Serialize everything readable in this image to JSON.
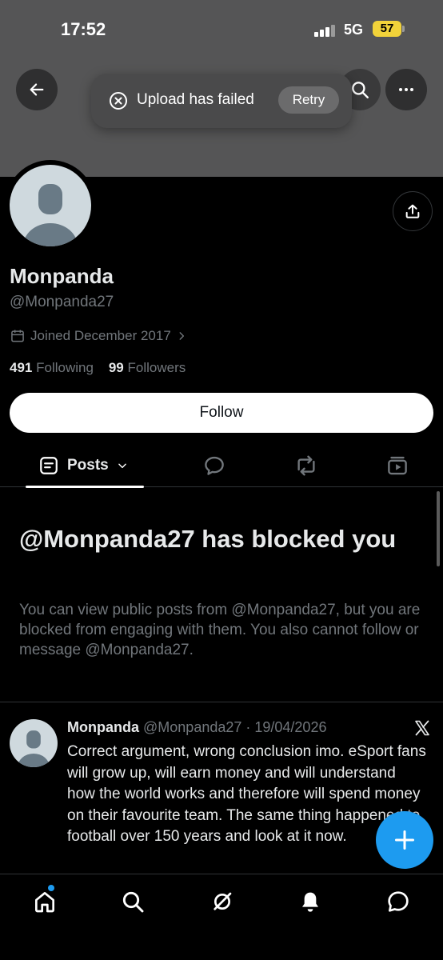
{
  "status_bar": {
    "time": "17:52",
    "network": "5G",
    "battery": "57"
  },
  "toast": {
    "message": "Upload has failed",
    "retry_label": "Retry"
  },
  "profile": {
    "display_name": "Monpanda",
    "handle": "@Monpanda27",
    "joined": "Joined December 2017",
    "following_count": "491",
    "following_label": "Following",
    "followers_count": "99",
    "followers_label": "Followers",
    "follow_button": "Follow"
  },
  "tabs": {
    "posts_label": "Posts"
  },
  "blocked": {
    "title": "@Monpanda27 has blocked you",
    "description": "You can view public posts from @Monpanda27, but you are blocked from engaging with them. You also cannot follow or message @Monpanda27."
  },
  "tweet": {
    "name": "Monpanda",
    "meta": "@Monpanda27 · 19/04/2026",
    "text": "Correct argument, wrong conclusion imo. eSport fans will grow up, will earn money and will understand how the world works and therefore will spend money on their favourite team. The same thing happened to football over 150 years and look at it now."
  },
  "colors": {
    "accent": "#1d9bf0",
    "banner": "#555556",
    "muted_text": "#71767b"
  },
  "icons": [
    "back-arrow-icon",
    "search-icon",
    "more-icon",
    "error-circle-icon",
    "share-icon",
    "calendar-icon",
    "chevron-right-icon",
    "posts-icon",
    "chevron-down-icon",
    "replies-icon",
    "repost-icon",
    "media-icon",
    "x-logo-icon",
    "plus-icon",
    "home-icon",
    "grok-icon",
    "bell-icon",
    "messages-icon"
  ]
}
